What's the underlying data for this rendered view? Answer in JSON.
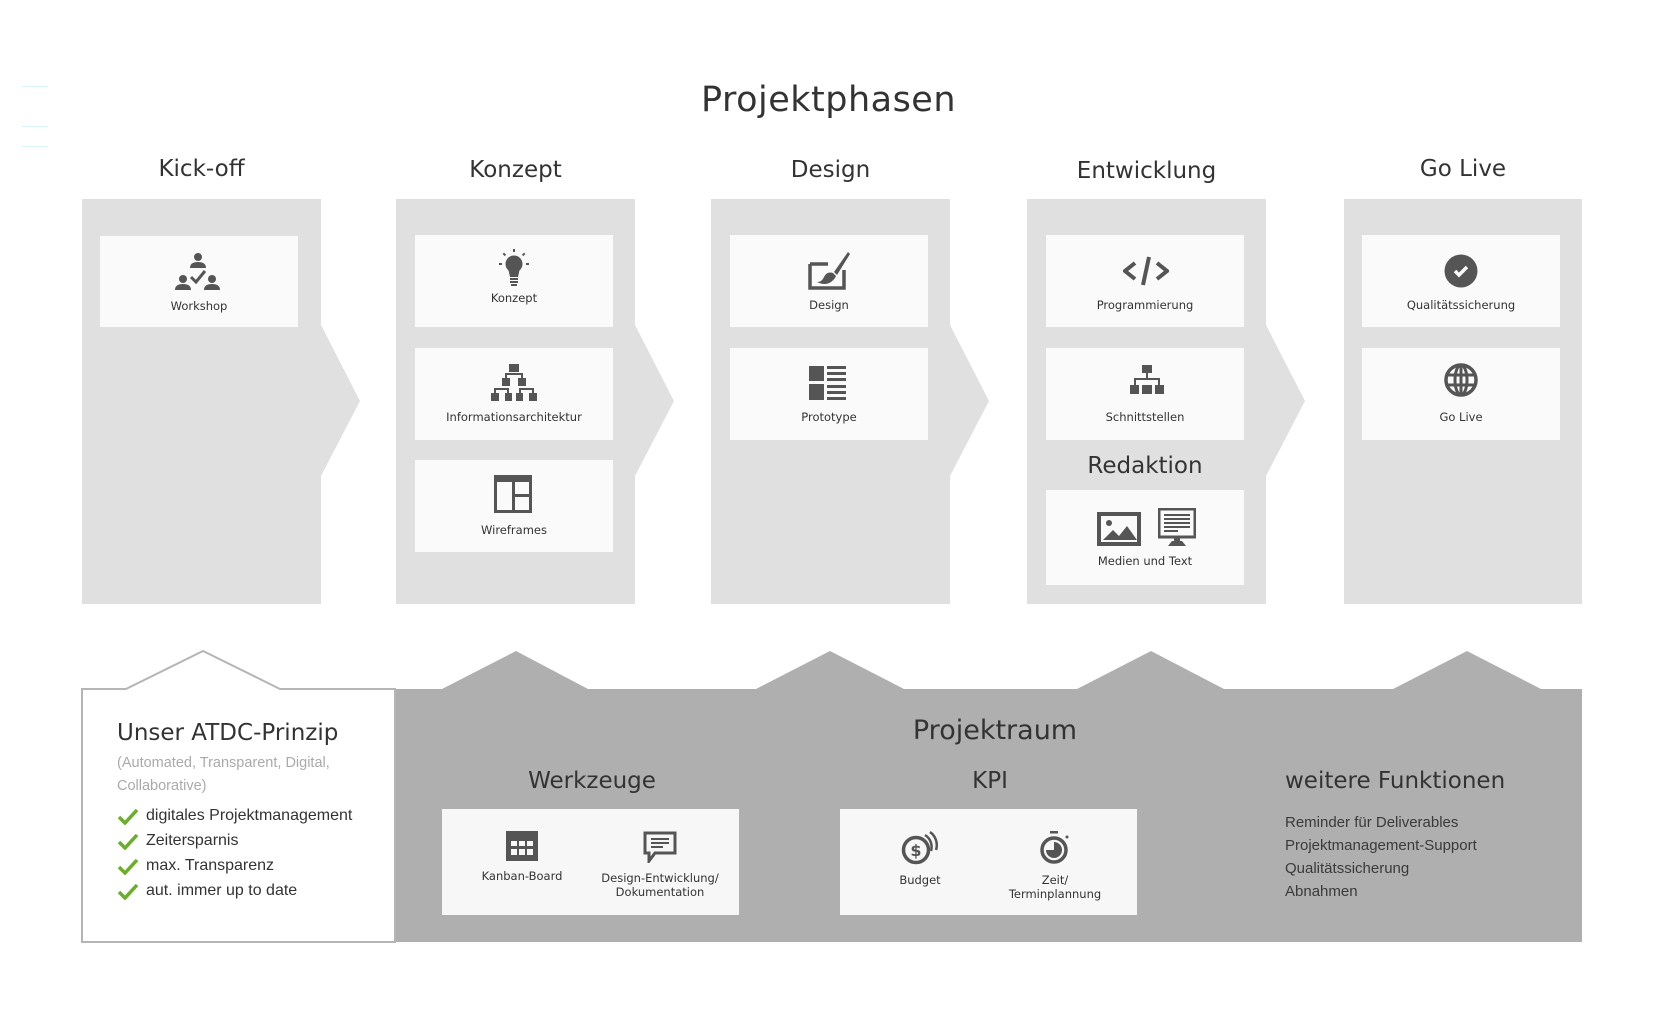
{
  "page": {
    "title": "Projektphasen"
  },
  "colors": {
    "phase_bg": "#e0e0e0",
    "card_bg": "#fafafa",
    "icon": "#555555",
    "projektraum_bg": "#afafaf",
    "check": "#6aae2a",
    "muted_text": "#aaaaaa"
  },
  "phases": [
    {
      "title": "Kick-off",
      "cards": [
        {
          "label": "Workshop",
          "icon": "team-check-icon"
        }
      ]
    },
    {
      "title": "Konzept",
      "cards": [
        {
          "label": "Konzept",
          "icon": "lightbulb-icon"
        },
        {
          "label": "Informationsarchitektur",
          "icon": "sitemap-icon"
        },
        {
          "label": "Wireframes",
          "icon": "wireframe-layout-icon"
        }
      ]
    },
    {
      "title": "Design",
      "cards": [
        {
          "label": "Design",
          "icon": "paintbrush-canvas-icon"
        },
        {
          "label": "Prototype",
          "icon": "thumbnail-list-icon"
        }
      ]
    },
    {
      "title": "Entwicklung",
      "cards": [
        {
          "label": "Programmierung",
          "icon": "code-icon"
        },
        {
          "label": "Schnittstellen",
          "icon": "network-icon"
        }
      ],
      "section_title": "Redaktion",
      "section_card": {
        "label": "Medien und Text",
        "icons": [
          "image-icon",
          "monitor-text-icon"
        ]
      }
    },
    {
      "title": "Go Live",
      "cards": [
        {
          "label": "Qualitätssicherung",
          "icon": "check-circle-icon"
        },
        {
          "label": "Go Live",
          "icon": "globe-icon"
        }
      ]
    }
  ],
  "atdc": {
    "title": "Unser ATDC-Prinzip",
    "subtitle": "(Automated, Transparent, Digital, Collaborative)",
    "items": [
      "digitales Projektmanagement",
      "Zeitersparnis",
      "max. Transparenz",
      "aut. immer up to date"
    ]
  },
  "projektraum": {
    "title": "Projektraum",
    "werkzeuge": {
      "title": "Werkzeuge",
      "items": [
        {
          "label": "Kanban-Board",
          "icon": "calendar-grid-icon"
        },
        {
          "label_line1": "Design-Entwicklung/",
          "label_line2": "Dokumentation",
          "icon": "speech-bubble-icon"
        }
      ]
    },
    "kpi": {
      "title": "KPI",
      "items": [
        {
          "label": "Budget",
          "icon": "coins-dollar-icon"
        },
        {
          "label_line1": "Zeit/",
          "label_line2": "Terminplannung",
          "icon": "stopwatch-icon"
        }
      ]
    },
    "weitere": {
      "title": "weitere Funktionen",
      "items": [
        "Reminder für Deliverables",
        "Projektmanagement-Support",
        "Qualitätssicherung",
        "Abnahmen"
      ]
    }
  }
}
